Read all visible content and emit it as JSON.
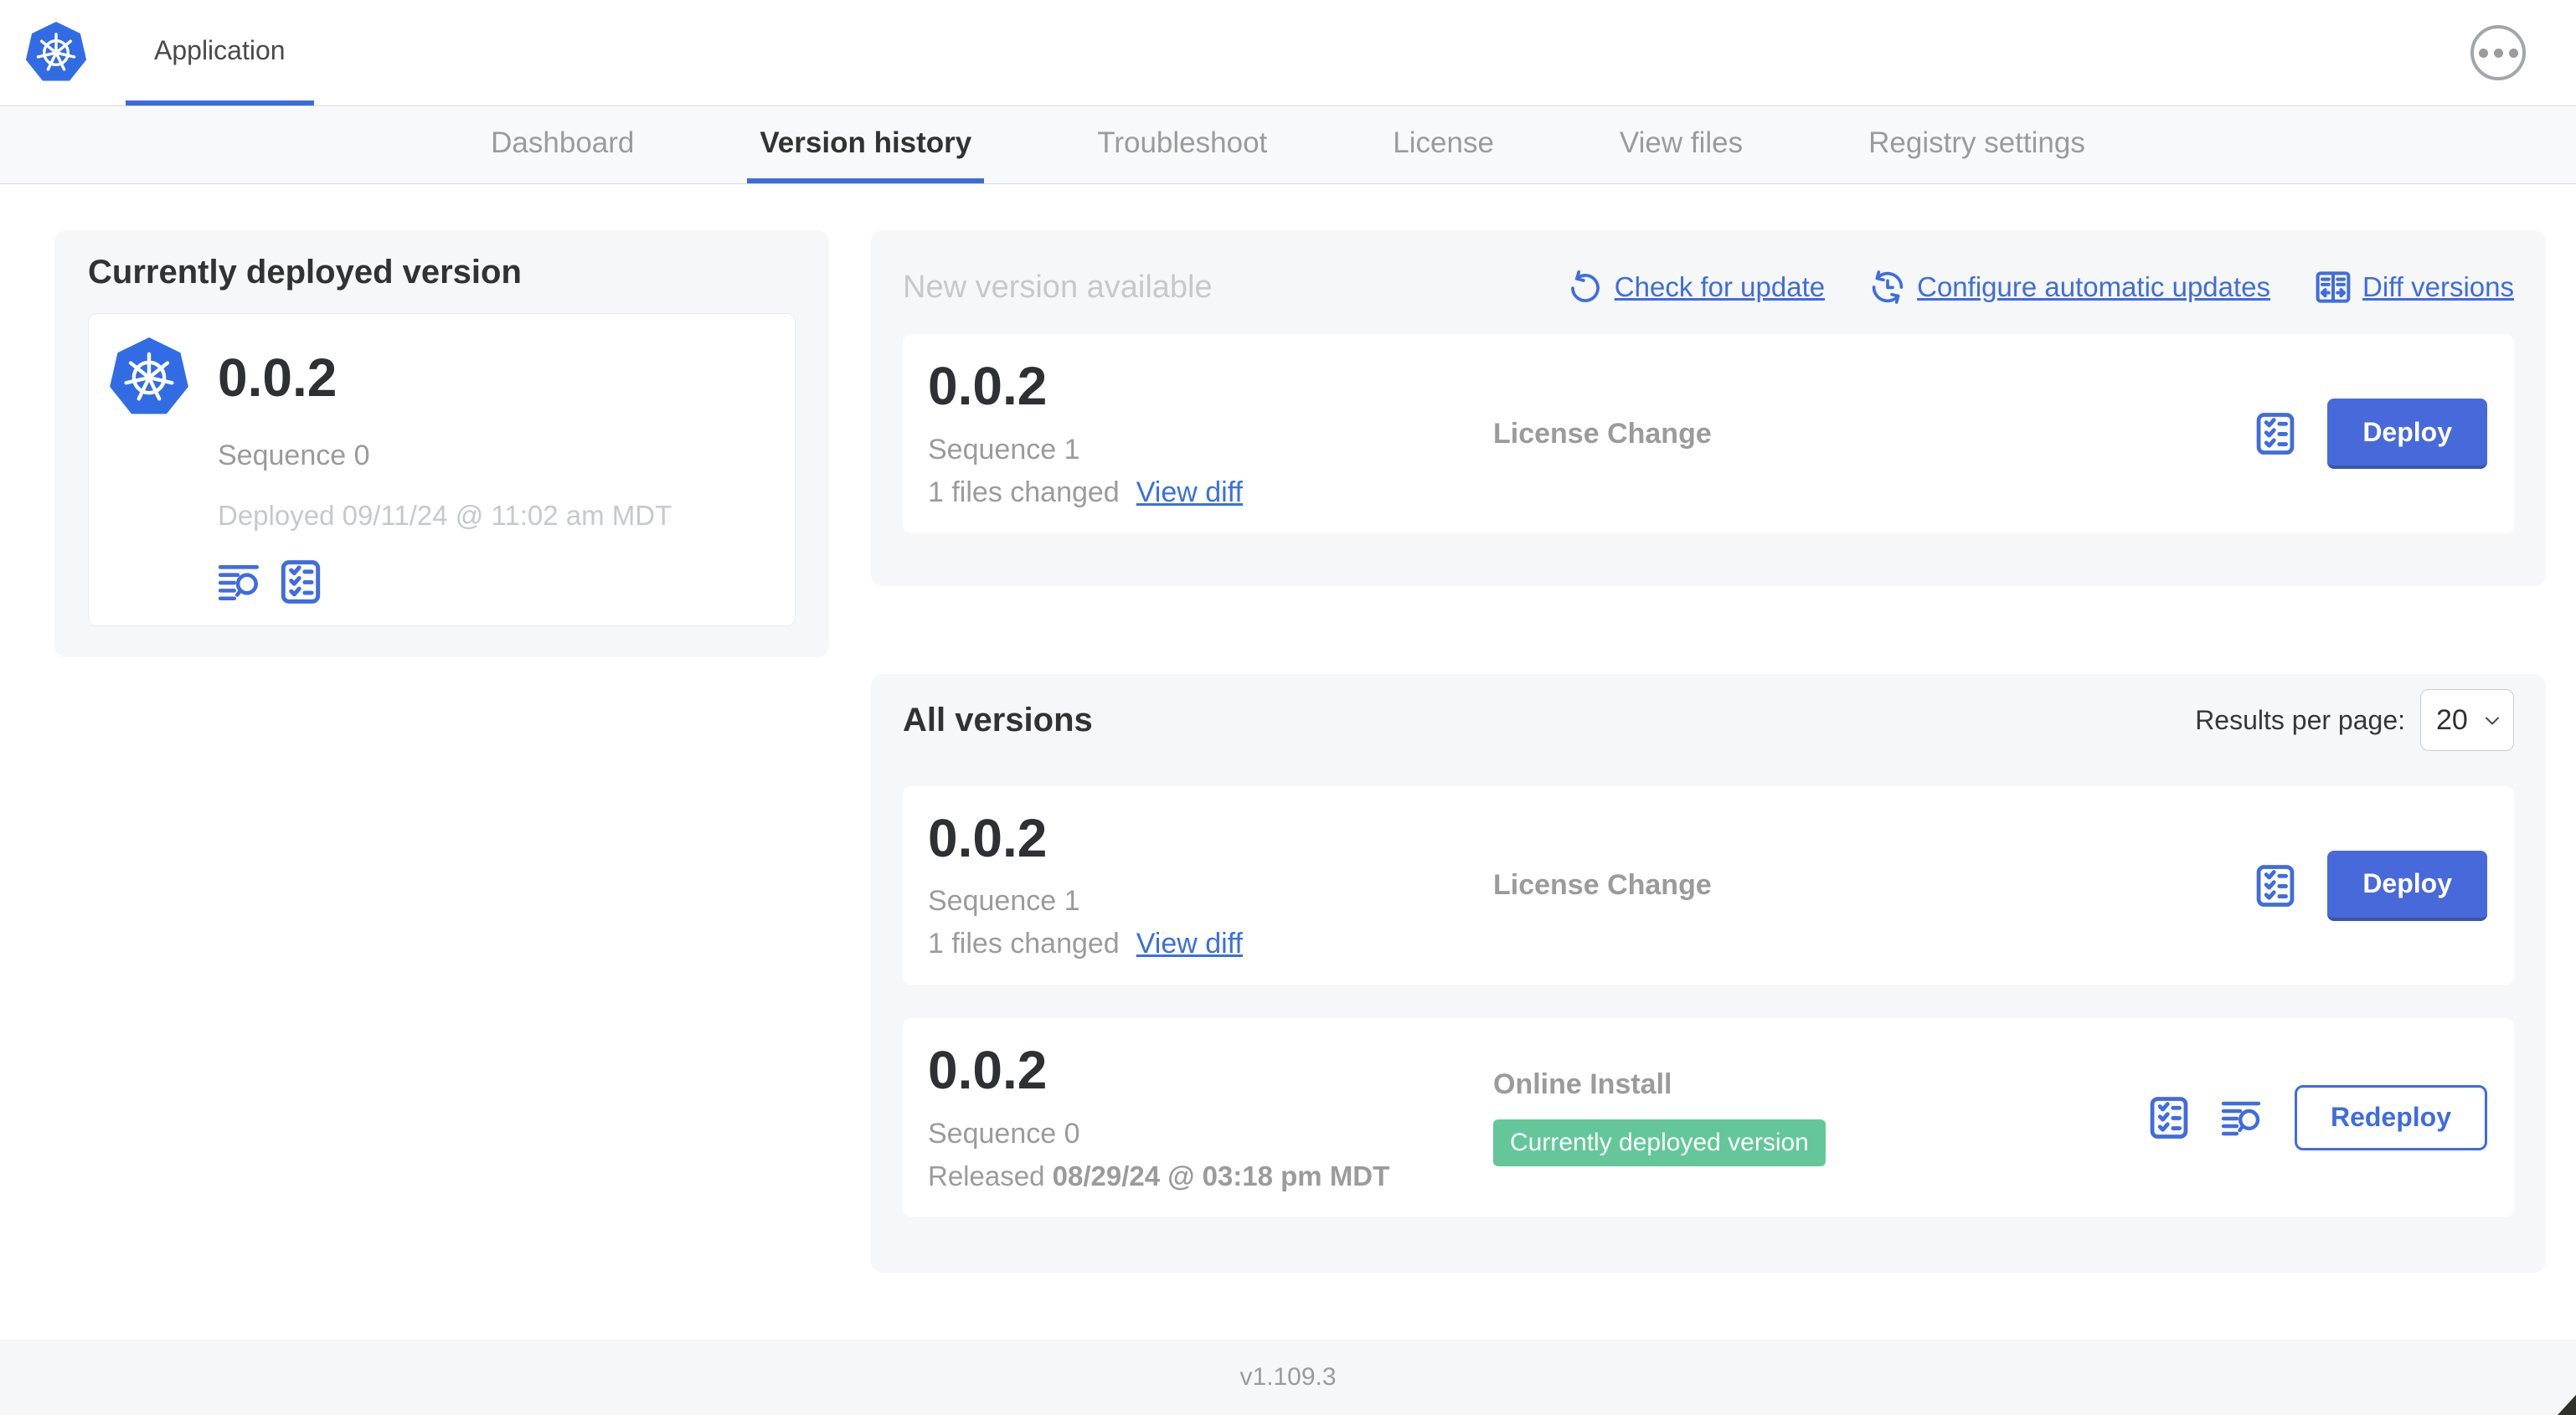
{
  "app_header": {
    "title": "Application"
  },
  "tabs": [
    {
      "label": "Dashboard"
    },
    {
      "label": "Version history"
    },
    {
      "label": "Troubleshoot"
    },
    {
      "label": "License"
    },
    {
      "label": "View files"
    },
    {
      "label": "Registry settings"
    }
  ],
  "current_version": {
    "title": "Currently deployed version",
    "version": "0.0.2",
    "sequence": "Sequence 0",
    "deployed_timestamp": "Deployed 09/11/24 @ 11:02 am MDT"
  },
  "new_version": {
    "title": "New version available",
    "links": [
      {
        "label": "Check for update",
        "icon": "refresh-ccw"
      },
      {
        "label": "Configure automatic updates",
        "icon": "clock-refresh"
      },
      {
        "label": "Diff versions",
        "icon": "split-diff"
      }
    ],
    "card": {
      "version": "0.0.2",
      "sequence": "Sequence 1",
      "files_changed": "1 files changed",
      "view_diff": "View diff",
      "source": "License Change",
      "action": "Deploy"
    }
  },
  "all_versions": {
    "title": "All versions",
    "results_per_page": {
      "label": "Results per page:",
      "value": "20"
    },
    "rows": [
      {
        "version": "0.0.2",
        "sequence": "Sequence 1",
        "files_changed": "1 files changed",
        "view_diff": "View diff",
        "source": "License Change",
        "action": "Deploy"
      },
      {
        "version": "0.0.2",
        "sequence": "Sequence 0",
        "released_label": "Released",
        "released_timestamp": "08/29/24 @ 03:18 pm MDT",
        "source": "Online Install",
        "badge": "Currently deployed version",
        "action": "Redeploy"
      }
    ]
  },
  "footer": {
    "app_manager_version": "v1.109.3"
  },
  "icons": {
    "app_logo": "kubernetes-wheel",
    "header_menu": "ellipsis-circle",
    "release_notes": "log-search",
    "preflight_checks": "checklist",
    "check_for_update": "refresh-ccw",
    "configure_updates": "clock-refresh",
    "diff_versions": "split-diff",
    "results_select": "chevron-down"
  },
  "colors": {
    "accent_blue": "#3f6cdf",
    "button_blue": "#4769d9",
    "kubernetes_blue": "#326ce5",
    "badge_green": "#63c79a",
    "section_bg": "#f5f7f9",
    "dark_text": "#323232",
    "gray_text": "#9b9b9b",
    "light_gray_text": "#c6c9cc"
  }
}
